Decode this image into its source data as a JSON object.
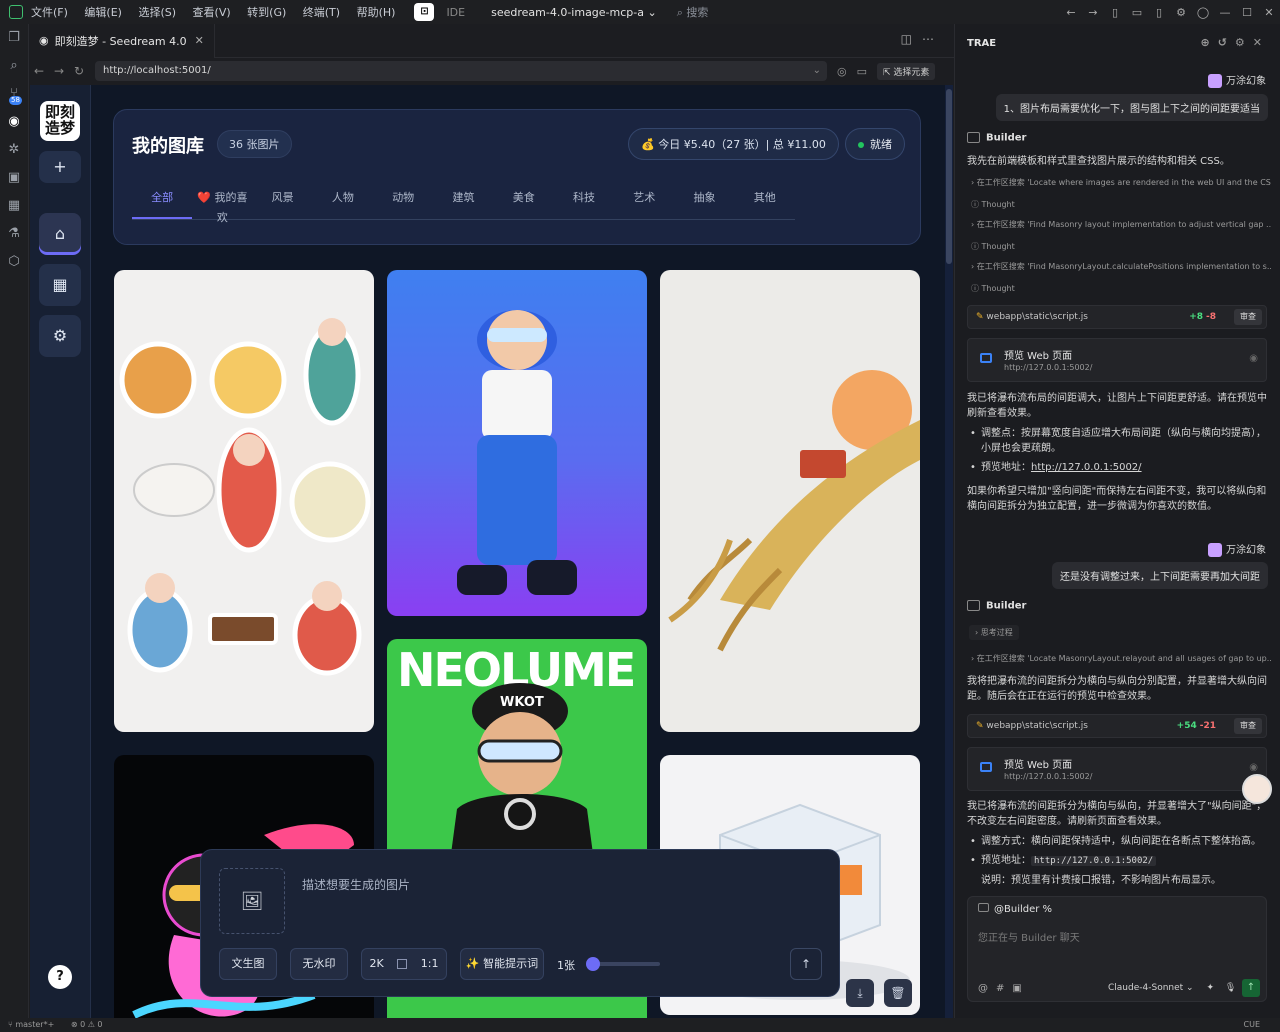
{
  "titlebar": {
    "menus": [
      "文件(F)",
      "编辑(E)",
      "选择(S)",
      "查看(V)",
      "转到(G)",
      "终端(T)",
      "帮助(H)"
    ],
    "ide_label": "IDE",
    "project": "seedream-4.0-image-mcp-a",
    "search": "搜索"
  },
  "activity": {
    "badge": "58"
  },
  "editor": {
    "tab_title": "即刻造梦 - Seedream 4.0",
    "url": "http://localhost:5001/",
    "pick_element": "选择元素"
  },
  "app": {
    "brand": "即刻造梦",
    "library_title": "我的图库",
    "image_count": "36 张图片",
    "cost": "今日 ¥5.40（27 张）| 总 ¥11.00",
    "status": "就绪",
    "categories": [
      "全部",
      "❤️ 我的喜欢",
      "风景",
      "人物",
      "动物",
      "建筑",
      "美食",
      "科技",
      "艺术",
      "抽象",
      "其他"
    ],
    "card_text": "NEOLUME",
    "card_cap_text": "WKOT",
    "generator": {
      "placeholder": "描述想要生成的图片",
      "mode": "文生图",
      "watermark": "无水印",
      "resolution": "2K",
      "ratio": "1:1",
      "smart_prompt": "✨ 智能提示词",
      "count": "1张"
    },
    "help": "?"
  },
  "chat": {
    "title": "TRAE",
    "user_name": "万涂幻象",
    "user_msg_1": "1、图片布局需要优化一下，图与图上下之间的间距要适当",
    "bot_name": "Builder",
    "bot_msg_1": "我先在前端模板和样式里查找图片展示的结构和相关 CSS。",
    "steps_1": [
      "› 在工作区搜索 'Locate where images are rendered in the web UI and the CS...",
      "ⓘ Thought",
      "› 在工作区搜索 'Find Masonry layout implementation to adjust vertical gap ...",
      "ⓘ Thought",
      "› 在工作区搜索 'Find MasonryLayout.calculatePositions implementation to s...",
      "ⓘ Thought"
    ],
    "file_1": {
      "path": "webapp\\static\\script.js",
      "add": "+8",
      "del": "-8",
      "review": "审查"
    },
    "preview_title": "预览 Web 页面",
    "preview_url": "http://127.0.0.1:5002/",
    "bot_msg_2": "我已将瀑布流布局的间距调大，让图片上下间距更舒适。请在预览中刷新查看效果。",
    "bullet_1": "调整点：按屏幕宽度自适应增大布局间距（纵向与横向均提高），小屏也会更疏朗。",
    "bullet_2_label": "预览地址：",
    "bullet_2_url": "http://127.0.0.1:5002/",
    "bot_msg_3": "如果你希望只增加\"竖向间距\"而保持左右间距不变，我可以将纵向和横向间距拆分为独立配置，进一步微调为你喜欢的数值。",
    "user_msg_2": "还是没有调整过来，上下间距需要再加大间距",
    "thinking": "思考过程",
    "step_2": "› 在工作区搜索 'Locate MasonryLayout.relayout and all usages of gap to up...",
    "bot_msg_4": "我将把瀑布流的间距拆分为横向与纵向分别配置，并显著增大纵向间距。随后会在正在运行的预览中检查效果。",
    "file_2": {
      "path": "webapp\\static\\script.js",
      "add": "+54",
      "del": "-21",
      "review": "审查"
    },
    "bot_msg_5": "我已将瀑布流的间距拆分为横向与纵向，并显著增大了\"纵向间距\"，不改变左右间距密度。请刷新页面查看效果。",
    "bullet_3": "调整方式：横向间距保持适中，纵向间距在各断点下整体抬高。",
    "bullet_4_label": "预览地址：",
    "bullet_4_url": "http://127.0.0.1:5002/",
    "bullet_5": "说明：预览里有计费接口报错，不影响图片布局显示。",
    "input_at": "@Builder",
    "input_placeholder": "您正在与 Builder 聊天",
    "model": "Claude-4-Sonnet"
  },
  "statusbar": {
    "branch": "master*+",
    "problems": "⊗ 0 ⚠ 0",
    "right": "CUE"
  }
}
